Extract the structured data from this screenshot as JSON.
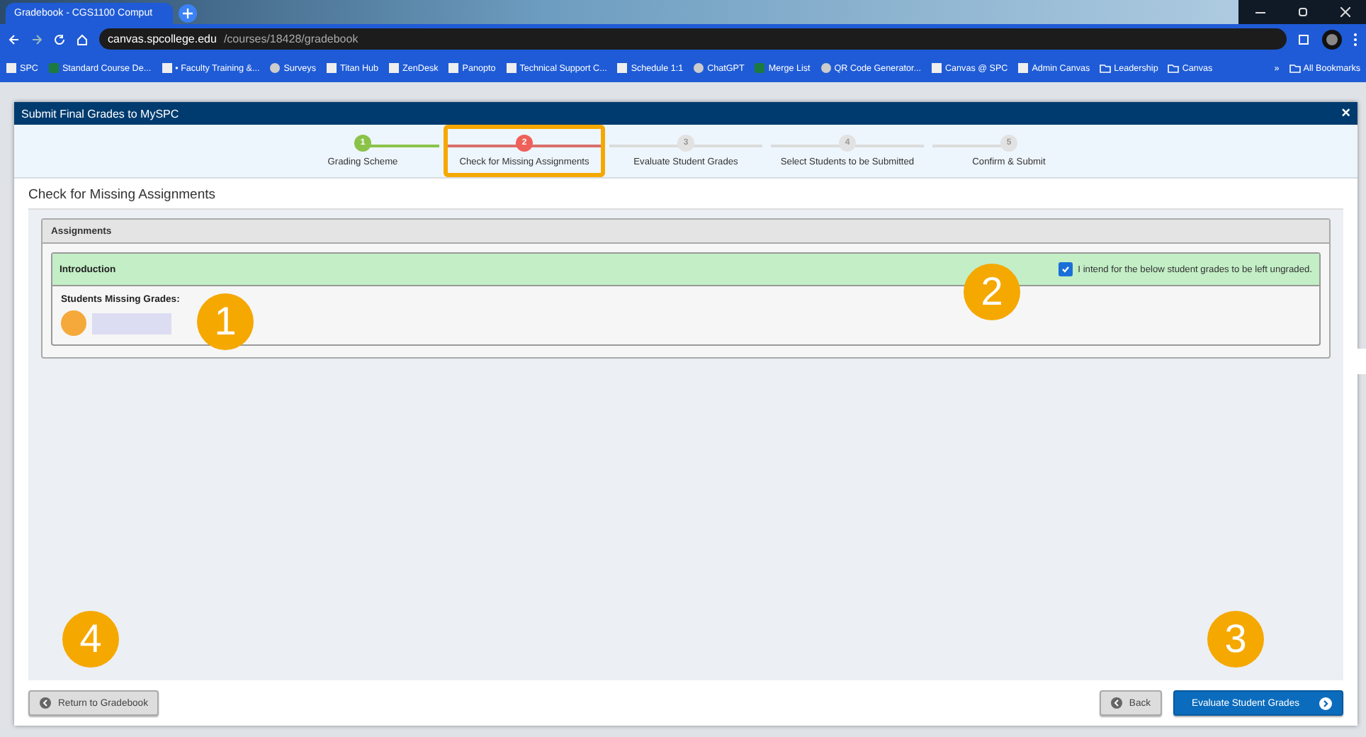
{
  "browser": {
    "tab": {
      "title": "Gradebook - CGS1100 Comput"
    },
    "address": {
      "host": "canvas.spcollege.edu",
      "path": "/courses/18428/gradebook"
    },
    "bookmarks": [
      {
        "label": "SPC",
        "kind": "site"
      },
      {
        "label": "Standard Course De...",
        "kind": "sheet"
      },
      {
        "label": "• Faculty Training &...",
        "kind": "site"
      },
      {
        "label": "Surveys",
        "kind": "globe"
      },
      {
        "label": "Titan Hub",
        "kind": "site"
      },
      {
        "label": "ZenDesk",
        "kind": "site"
      },
      {
        "label": "Panopto",
        "kind": "site"
      },
      {
        "label": "Technical Support C...",
        "kind": "site"
      },
      {
        "label": "Schedule 1:1",
        "kind": "site"
      },
      {
        "label": "ChatGPT",
        "kind": "globe"
      },
      {
        "label": "Merge List",
        "kind": "sheet"
      },
      {
        "label": "QR Code Generator...",
        "kind": "globe"
      },
      {
        "label": "Canvas @ SPC",
        "kind": "site"
      },
      {
        "label": "Admin Canvas",
        "kind": "site"
      },
      {
        "label": "Leadership",
        "kind": "folder"
      },
      {
        "label": "Canvas",
        "kind": "folder"
      }
    ],
    "more": "»",
    "all_bookmarks": "All Bookmarks"
  },
  "dialog": {
    "title": "Submit Final Grades to MySPC",
    "close": "×",
    "steps": [
      {
        "number": "1",
        "label": "Grading Scheme",
        "completed": true,
        "selected": false,
        "highlighted": false
      },
      {
        "number": "2",
        "label": "Check for Missing Assignments",
        "completed": false,
        "selected": true,
        "highlighted": true
      },
      {
        "number": "3",
        "label": "Evaluate Student Grades",
        "completed": false,
        "selected": false,
        "highlighted": false
      },
      {
        "number": "4",
        "label": "Select Students to be Submitted",
        "completed": false,
        "selected": false,
        "highlighted": false
      },
      {
        "number": "5",
        "label": "Confirm & Submit",
        "completed": false,
        "selected": false,
        "highlighted": false
      }
    ],
    "heading": "Check for Missing Assignments",
    "panel": {
      "title": "Assignments",
      "assignment": {
        "name": "Introduction",
        "checkbox": {
          "label": "I intend for the below student grades to be left ungraded.",
          "checked": true
        },
        "missing_label": "Students Missing Grades:"
      }
    },
    "footer": {
      "return": "Return to Gradebook",
      "back": "Back",
      "next": "Evaluate Student Grades"
    }
  },
  "callouts": [
    {
      "label": "1"
    },
    {
      "label": "2"
    },
    {
      "label": "3"
    },
    {
      "label": "4"
    }
  ]
}
